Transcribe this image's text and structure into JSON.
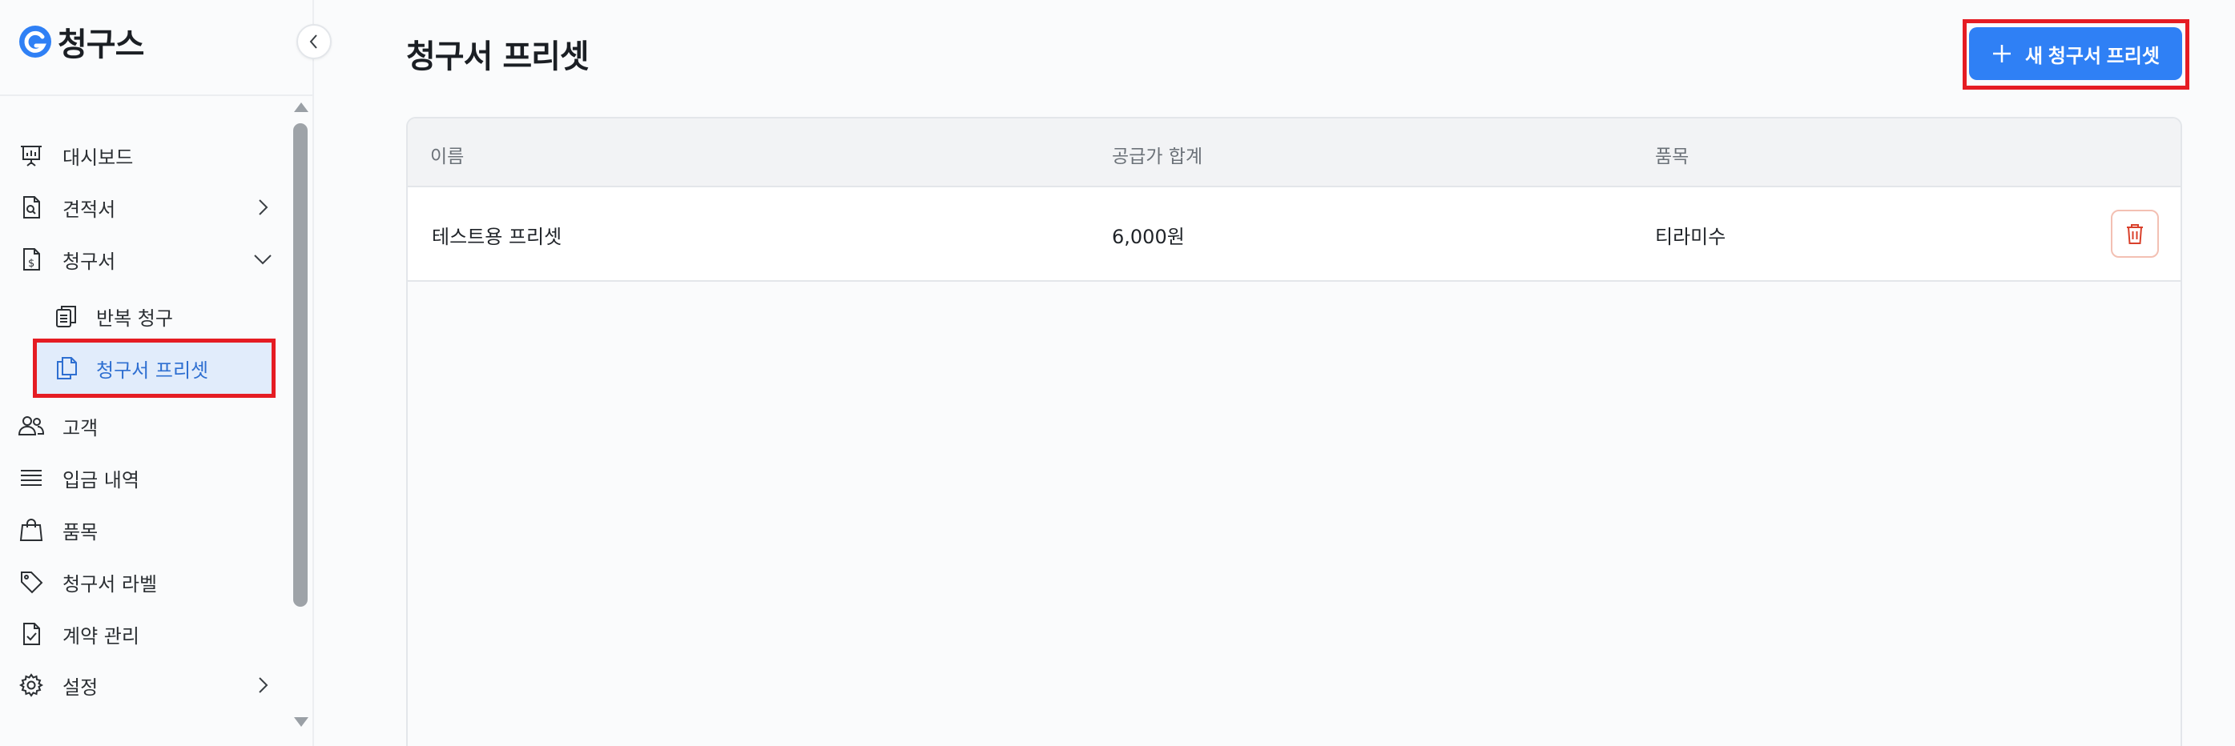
{
  "brand": {
    "name": "청구스",
    "accent": "#2f80f5"
  },
  "sidebar": {
    "items": [
      {
        "label": "대시보드",
        "icon": "presentation-board-icon"
      },
      {
        "label": "견적서",
        "icon": "document-search-icon",
        "chevron": "right"
      },
      {
        "label": "청구서",
        "icon": "document-dollar-icon",
        "chevron": "down"
      },
      {
        "label": "반복 청구",
        "icon": "clipboard-copy-icon",
        "sub": true
      },
      {
        "label": "청구서 프리셋",
        "icon": "files-copy-icon",
        "sub": true,
        "active": true
      },
      {
        "label": "고객",
        "icon": "users-icon"
      },
      {
        "label": "입금 내역",
        "icon": "list-lines-icon"
      },
      {
        "label": "품목",
        "icon": "shopping-bag-icon"
      },
      {
        "label": "청구서 라벨",
        "icon": "tag-icon"
      },
      {
        "label": "계약 관리",
        "icon": "document-check-icon"
      },
      {
        "label": "설정",
        "icon": "gear-icon",
        "chevron": "right"
      }
    ]
  },
  "main": {
    "title": "청구서 프리셋",
    "new_button_label": "새 청구서 프리셋",
    "table": {
      "columns": [
        "이름",
        "공급가 합계",
        "품목"
      ],
      "rows": [
        {
          "name": "테스트용 프리셋",
          "total": "6,000원",
          "items": "티라미수"
        }
      ]
    }
  },
  "colors": {
    "highlight": "#e51c23",
    "active_bg": "#e1ecfb",
    "active_text": "#2e6fd1",
    "danger": "#d9402b"
  }
}
